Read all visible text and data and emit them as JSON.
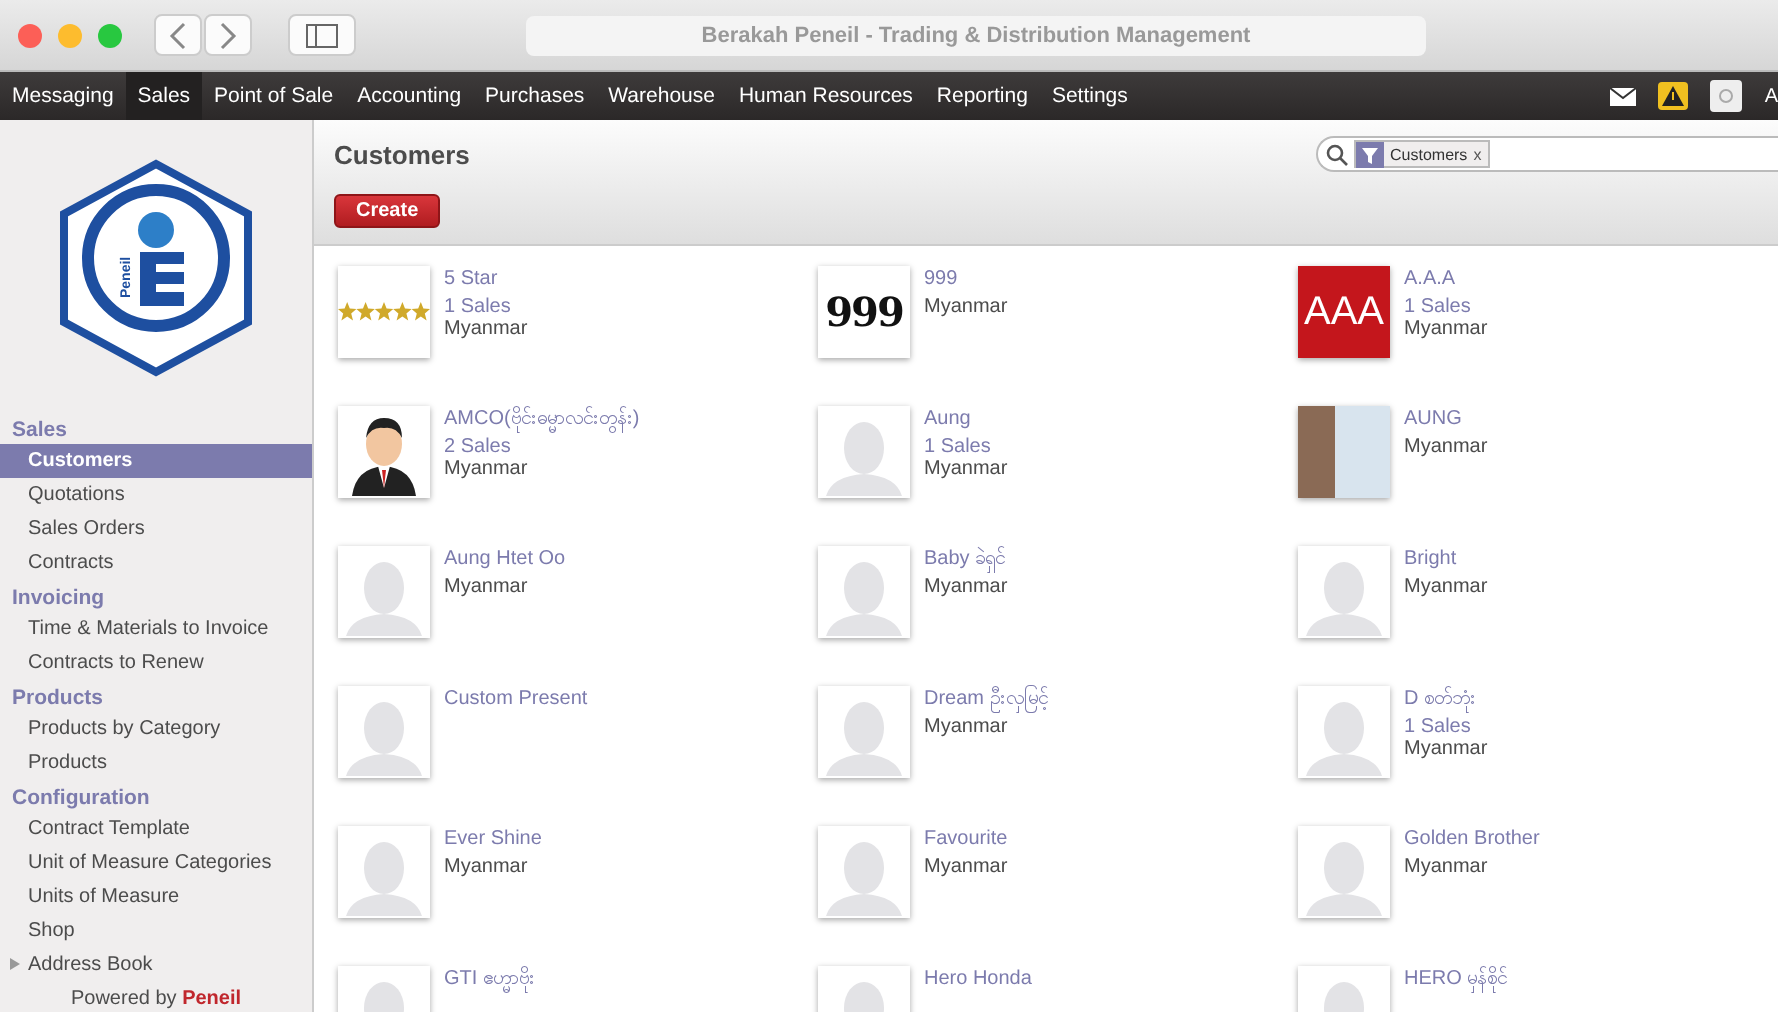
{
  "window": {
    "title": "Berakah Peneil - Trading & Distribution Management"
  },
  "menu": [
    {
      "label": "Messaging",
      "selected": false
    },
    {
      "label": "Sales",
      "selected": true
    },
    {
      "label": "Point of Sale",
      "selected": false
    },
    {
      "label": "Accounting",
      "selected": false
    },
    {
      "label": "Purchases",
      "selected": false
    },
    {
      "label": "Warehouse",
      "selected": false
    },
    {
      "label": "Human Resources",
      "selected": false
    },
    {
      "label": "Reporting",
      "selected": false
    },
    {
      "label": "Settings",
      "selected": false
    }
  ],
  "user": {
    "initial": "A"
  },
  "logo": {
    "text": "Peneil"
  },
  "sidebar": [
    {
      "title": "Sales",
      "items": [
        {
          "label": "Customers",
          "selected": true,
          "expandable": false
        },
        {
          "label": "Quotations",
          "selected": false,
          "expandable": false
        },
        {
          "label": "Sales Orders",
          "selected": false,
          "expandable": false
        },
        {
          "label": "Contracts",
          "selected": false,
          "expandable": false
        }
      ]
    },
    {
      "title": "Invoicing",
      "items": [
        {
          "label": "Time & Materials to Invoice",
          "selected": false,
          "expandable": false
        },
        {
          "label": "Contracts to Renew",
          "selected": false,
          "expandable": false
        }
      ]
    },
    {
      "title": "Products",
      "items": [
        {
          "label": "Products by Category",
          "selected": false,
          "expandable": false
        },
        {
          "label": "Products",
          "selected": false,
          "expandable": false
        }
      ]
    },
    {
      "title": "Configuration",
      "items": [
        {
          "label": "Contract Template",
          "selected": false,
          "expandable": false
        },
        {
          "label": "Unit of Measure Categories",
          "selected": false,
          "expandable": false
        },
        {
          "label": "Units of Measure",
          "selected": false,
          "expandable": false
        },
        {
          "label": "Shop",
          "selected": false,
          "expandable": false
        },
        {
          "label": "Address Book",
          "selected": false,
          "expandable": true
        }
      ]
    }
  ],
  "powered_by": {
    "text": "Powered by",
    "brand": "Peneil"
  },
  "page": {
    "title": "Customers",
    "create_button": "Create",
    "search": {
      "facet": "Customers",
      "facet_remove": "x"
    }
  },
  "customers": [
    {
      "name": "5 Star",
      "sales": "1 Sales",
      "country": "Myanmar",
      "kind": "stars"
    },
    {
      "name": "999",
      "country": "Myanmar",
      "kind": "numeral",
      "logo_text": "999"
    },
    {
      "name": "A.A.A",
      "sales": "1 Sales",
      "country": "Myanmar",
      "kind": "letters",
      "logo_text": "AAA"
    },
    {
      "name": "AMCO(ဗိုင်းဓမ္မာလင်းတွန်း)",
      "sales": "2 Sales",
      "country": "Myanmar",
      "kind": "businessman"
    },
    {
      "name": "Aung",
      "sales": "1 Sales",
      "country": "Myanmar",
      "kind": "placeholder"
    },
    {
      "name": "AUNG",
      "country": "Myanmar",
      "kind": "photo"
    },
    {
      "name": "Aung Htet Oo",
      "country": "Myanmar",
      "kind": "placeholder"
    },
    {
      "name": "Baby ခဲရှင်",
      "country": "Myanmar",
      "kind": "placeholder"
    },
    {
      "name": "Bright",
      "country": "Myanmar",
      "kind": "placeholder"
    },
    {
      "name": "Custom Present",
      "kind": "placeholder"
    },
    {
      "name": "Dream ဦးလှမြင့်",
      "country": "Myanmar",
      "kind": "placeholder"
    },
    {
      "name": "D စတ်ဘုံး",
      "sales": "1 Sales",
      "country": "Myanmar",
      "kind": "placeholder"
    },
    {
      "name": "Ever Shine",
      "country": "Myanmar",
      "kind": "placeholder"
    },
    {
      "name": "Favourite",
      "country": "Myanmar",
      "kind": "placeholder"
    },
    {
      "name": "Golden Brother",
      "country": "Myanmar",
      "kind": "placeholder"
    },
    {
      "name": "GTI ဧဟ္မာဗိုး",
      "kind": "placeholder"
    },
    {
      "name": "Hero Honda",
      "kind": "placeholder"
    },
    {
      "name": "HERO မှန်စိုင်",
      "kind": "placeholder"
    }
  ]
}
